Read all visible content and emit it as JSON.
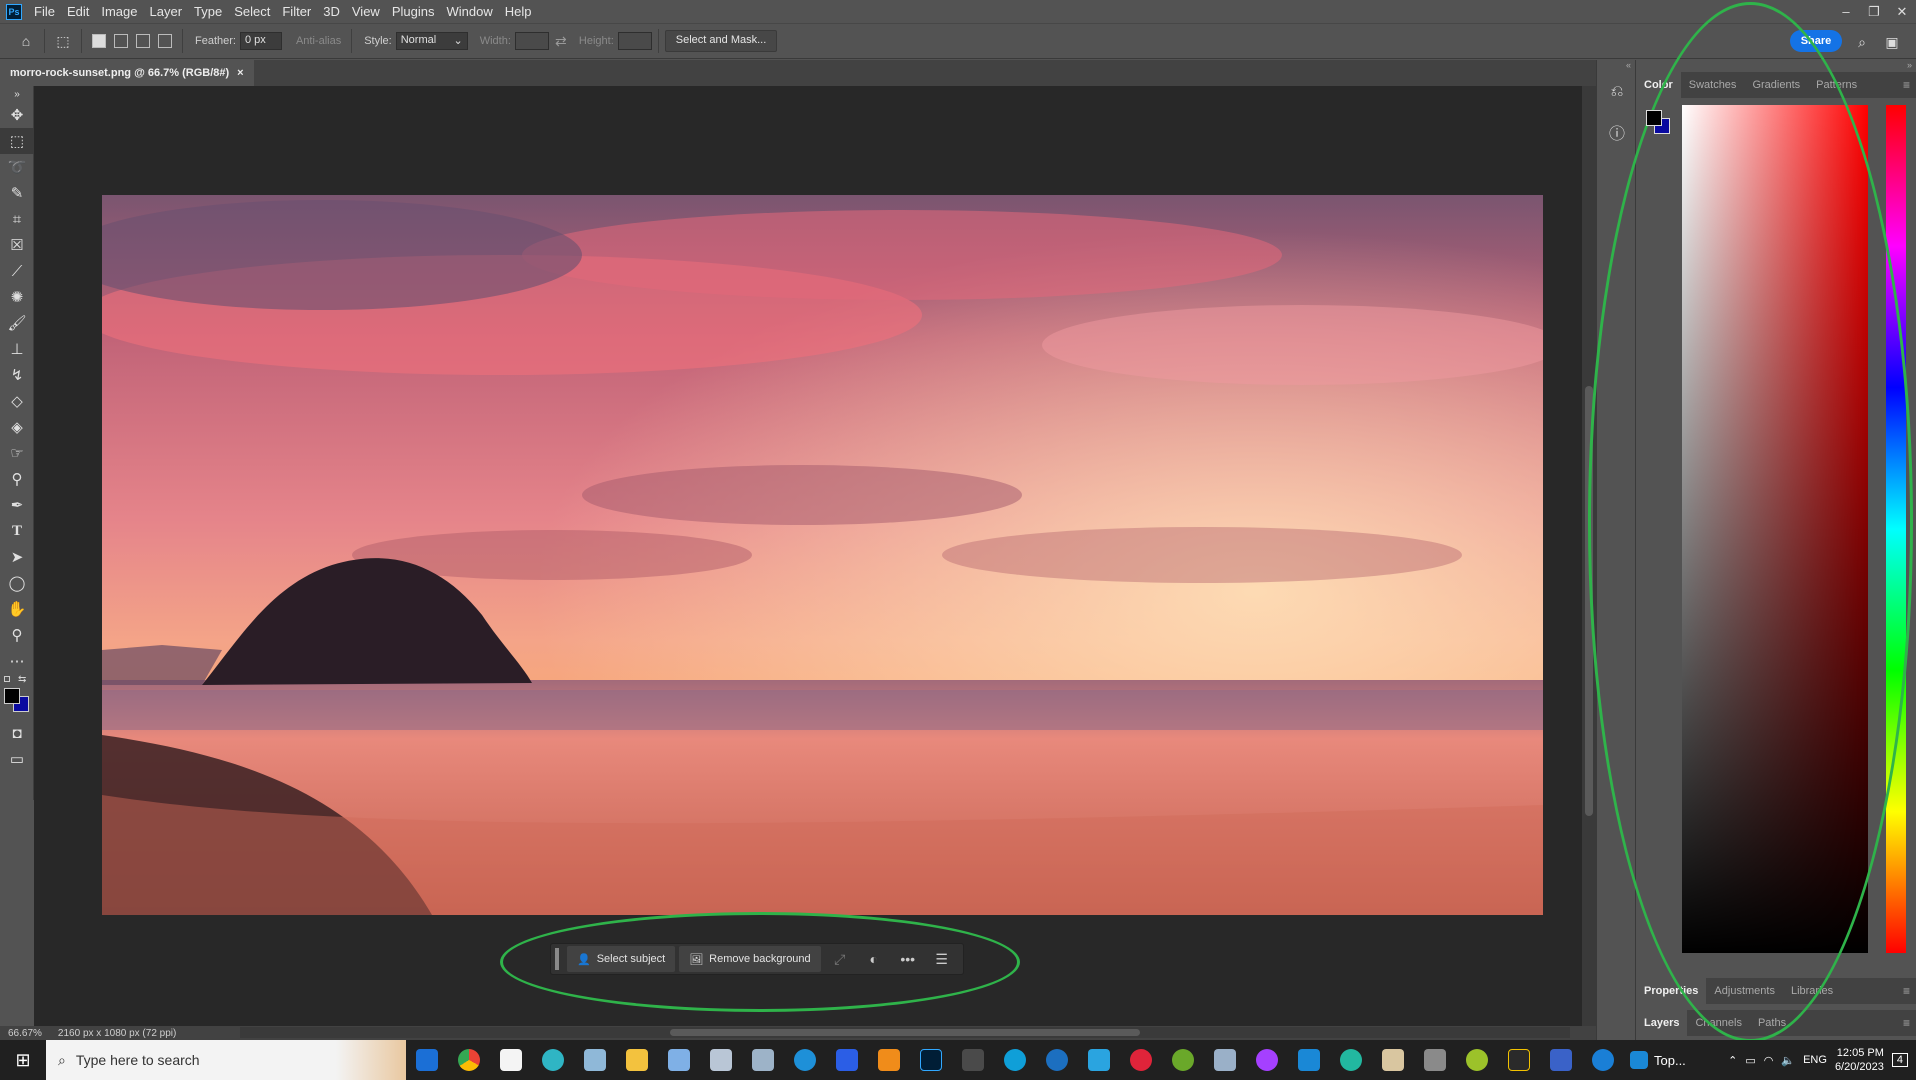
{
  "app": {
    "logo": "Ps"
  },
  "menu": [
    "File",
    "Edit",
    "Image",
    "Layer",
    "Type",
    "Select",
    "Filter",
    "3D",
    "View",
    "Plugins",
    "Window",
    "Help"
  ],
  "window_controls": {
    "minimize": "–",
    "restore": "❐",
    "close": "✕"
  },
  "options": {
    "feather_label": "Feather:",
    "feather_value": "0 px",
    "antialias_label": "Anti-alias",
    "style_label": "Style:",
    "style_value": "Normal",
    "width_label": "Width:",
    "height_label": "Height:",
    "select_mask_label": "Select and Mask...",
    "share_label": "Share"
  },
  "document": {
    "tab_title": "morro-rock-sunset.png @ 66.7% (RGB/8#)",
    "close": "×"
  },
  "contextual_task_bar": {
    "select_subject": "Select subject",
    "remove_background": "Remove background",
    "more": "•••"
  },
  "panels": {
    "top_tabs": [
      "Color",
      "Swatches",
      "Gradients",
      "Patterns"
    ],
    "properties_tabs": [
      "Properties",
      "Adjustments",
      "Libraries"
    ],
    "layers_tabs": [
      "Layers",
      "Channels",
      "Paths"
    ],
    "foreground_color": "#000000",
    "background_color": "#0a0aa0"
  },
  "status": {
    "zoom": "66.67%",
    "doc_info": "2160 px x 1080 px (72 ppi)"
  },
  "taskbar": {
    "search_placeholder": "Type here to search",
    "top_label": "Top...",
    "lang": "ENG",
    "time": "12:05 PM",
    "date": "6/20/2023",
    "notifications": "4"
  },
  "annotation_color": "#2fb34a"
}
